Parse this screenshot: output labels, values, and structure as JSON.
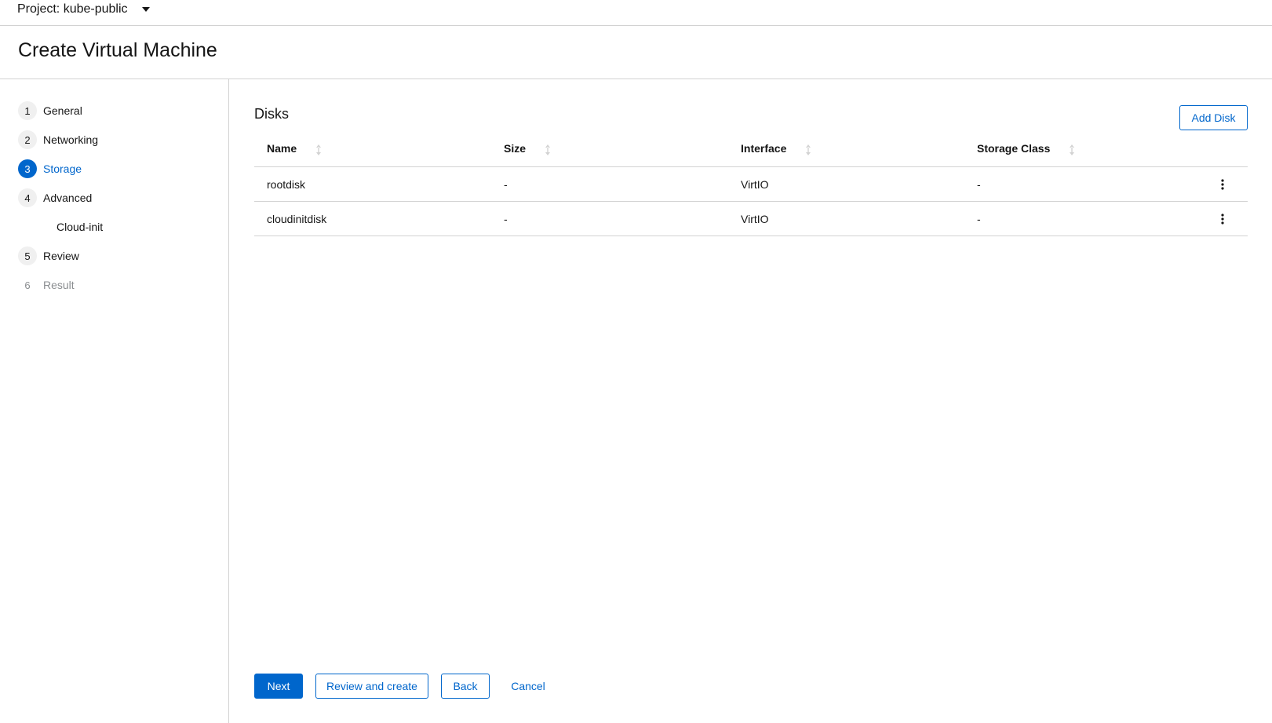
{
  "project": {
    "label": "Project: kube-public"
  },
  "page": {
    "title": "Create Virtual Machine"
  },
  "wizard": {
    "steps": [
      {
        "num": "1",
        "label": "General"
      },
      {
        "num": "2",
        "label": "Networking"
      },
      {
        "num": "3",
        "label": "Storage"
      },
      {
        "num": "4",
        "label": "Advanced"
      },
      {
        "num": "",
        "label": "Cloud-init"
      },
      {
        "num": "5",
        "label": "Review"
      },
      {
        "num": "6",
        "label": "Result"
      }
    ],
    "current_step": "Storage"
  },
  "disks": {
    "title": "Disks",
    "add_label": "Add Disk",
    "columns": [
      "Name",
      "Size",
      "Interface",
      "Storage Class"
    ],
    "rows": [
      {
        "name": "rootdisk",
        "size": "-",
        "interface": "VirtIO",
        "storage_class": "-"
      },
      {
        "name": "cloudinitdisk",
        "size": "-",
        "interface": "VirtIO",
        "storage_class": "-"
      }
    ]
  },
  "footer": {
    "next": "Next",
    "review_create": "Review and create",
    "back": "Back",
    "cancel": "Cancel"
  },
  "colors": {
    "accent": "#0066cc",
    "border": "#d2d2d2",
    "disabled": "#8a8d90"
  }
}
